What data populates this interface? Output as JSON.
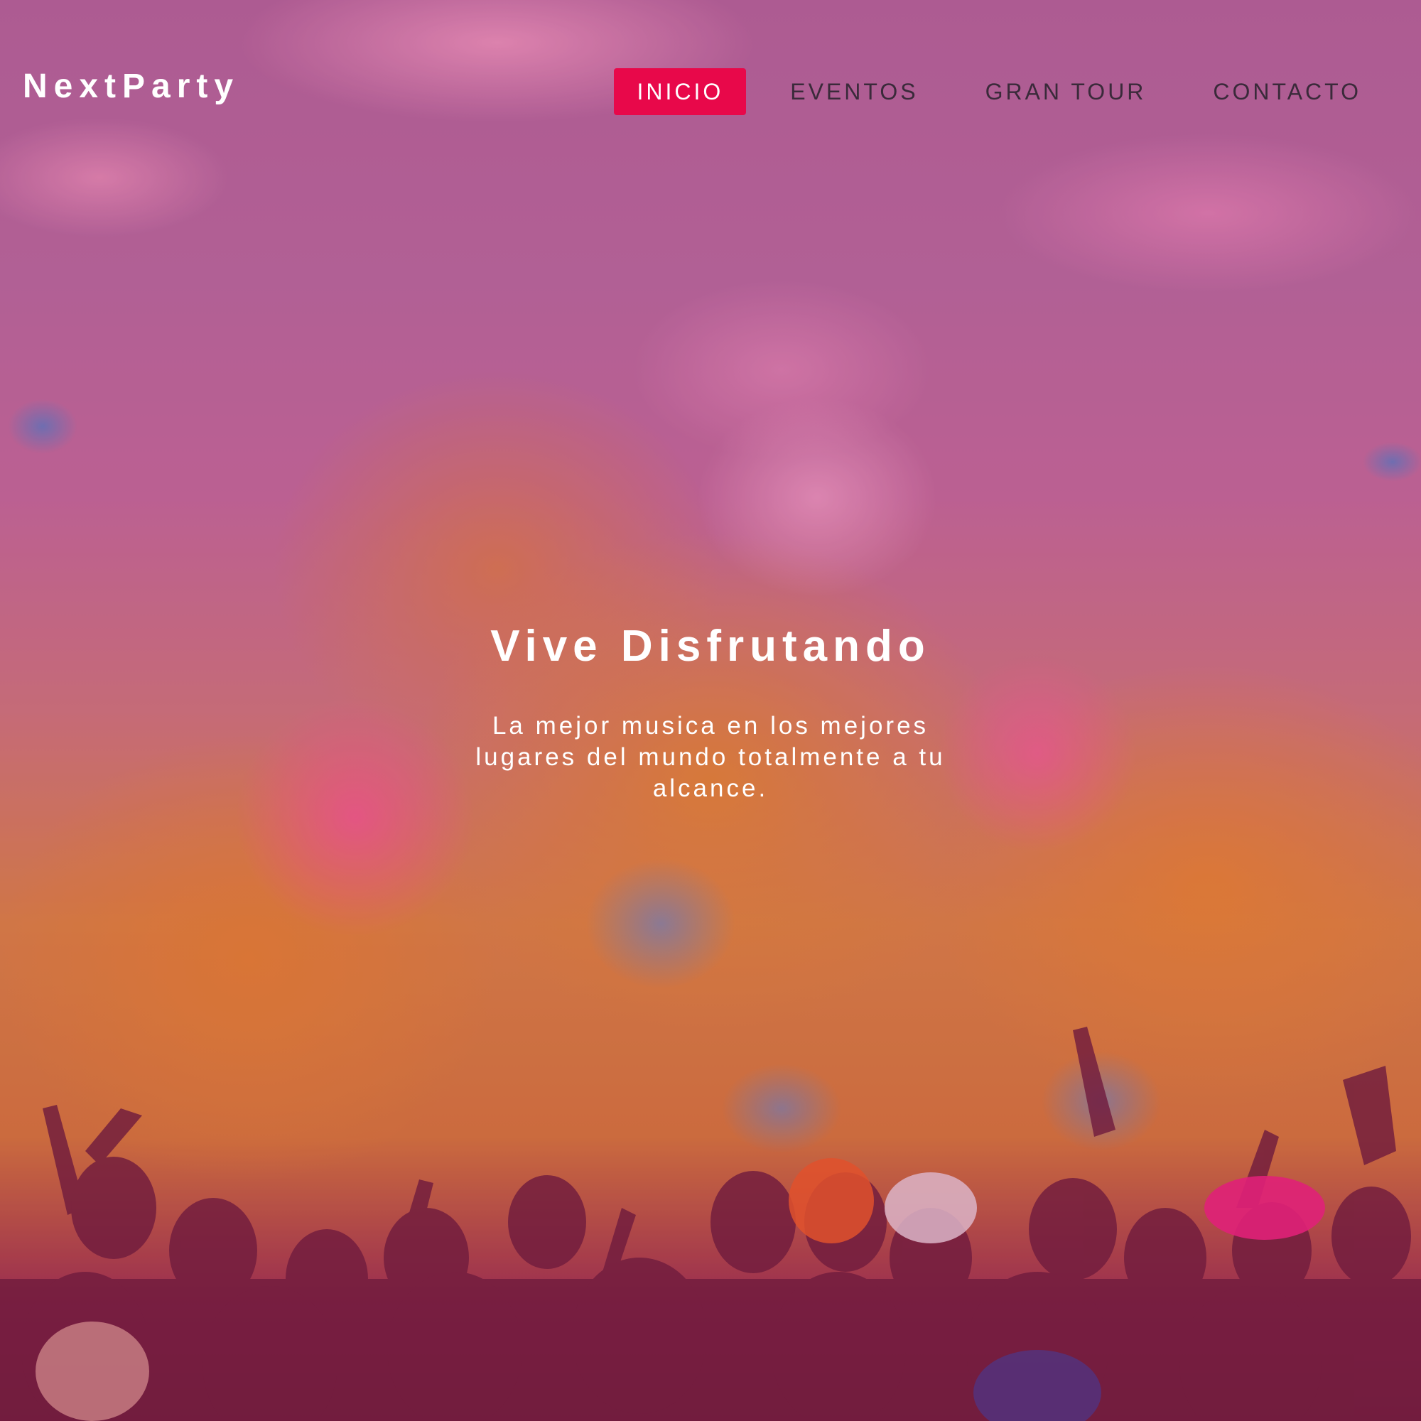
{
  "brand": {
    "name": "NextParty"
  },
  "nav": {
    "items": [
      {
        "label": "INICIO",
        "active": true
      },
      {
        "label": "EVENTOS",
        "active": false
      },
      {
        "label": "GRAN TOUR",
        "active": false
      },
      {
        "label": "CONTACTO",
        "active": false
      }
    ]
  },
  "hero": {
    "title": "Vive Disfrutando",
    "subtitle": "La mejor musica en los mejores lugares del mundo totalmente a tu alcance.",
    "background_image": "festival-crowd-color-powder-photo"
  },
  "colors": {
    "accent": "#e8084a",
    "text_light": "#ffffff",
    "nav_text": "#3a2a3a"
  }
}
